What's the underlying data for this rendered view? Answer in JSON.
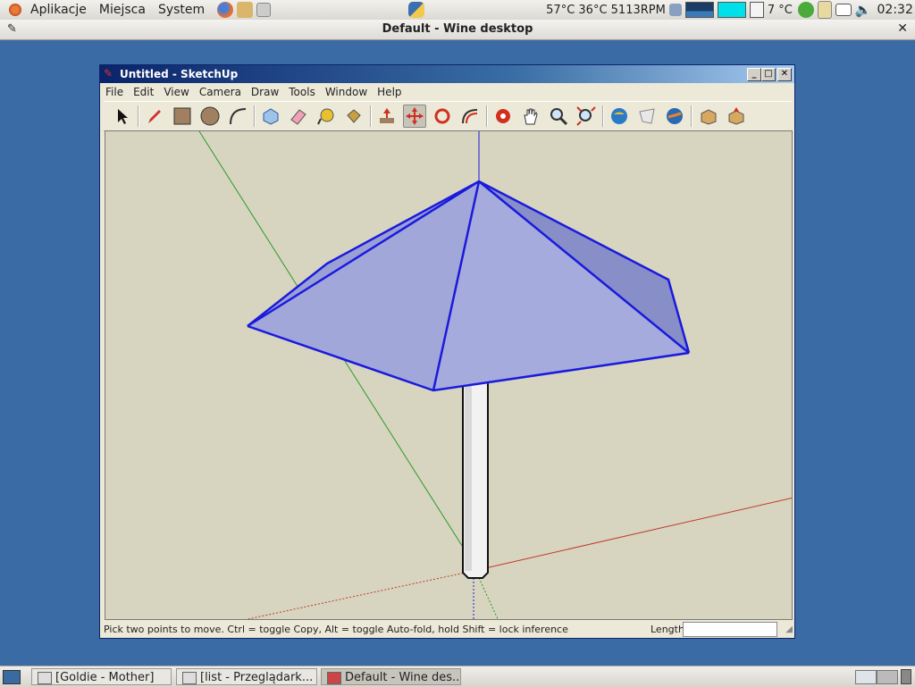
{
  "top_panel": {
    "menus": [
      "Aplikacje",
      "Miejsca",
      "System"
    ],
    "sensors": "57°C 36°C 5113RPM",
    "weather": "7 °C",
    "clock": "02:32"
  },
  "wine": {
    "title": "Default - Wine desktop"
  },
  "sketchup": {
    "title": "Untitled - SketchUp",
    "menu": [
      "File",
      "Edit",
      "View",
      "Camera",
      "Draw",
      "Tools",
      "Window",
      "Help"
    ],
    "toolbar": [
      "select-tool",
      "pencil-tool",
      "rectangle-tool",
      "circle-tool",
      "arc-tool",
      "eraser-tool",
      "paint-tool",
      "tape-measure-tool",
      "paint-bucket-tool",
      "push-pull-tool",
      "move-tool",
      "rotate-tool",
      "offset-tool",
      "orbit-tool",
      "pan-tool",
      "zoom-tool",
      "zoom-extents-tool",
      "get-models-tool",
      "share-model-tool",
      "google-earth-tool",
      "components-tool",
      "3d-warehouse-tool"
    ],
    "active_tool": "move-tool",
    "status": "Pick two points to move.  Ctrl = toggle Copy, Alt = toggle Auto-fold, hold Shift = lock inference",
    "length_label": "Length",
    "length_value": ""
  },
  "taskbar": {
    "items": [
      "[Goldie - Mother]",
      "[list - Przeglądark...",
      "Default - Wine des..."
    ],
    "active_index": 2
  },
  "colors": {
    "desktop": "#3b6ba4",
    "viewport": "#d7d5bf",
    "edge_blue": "#1a1adc",
    "face_fill": "#a2a7da",
    "axis_red": "#c0392b",
    "axis_green": "#2a9a2a"
  }
}
